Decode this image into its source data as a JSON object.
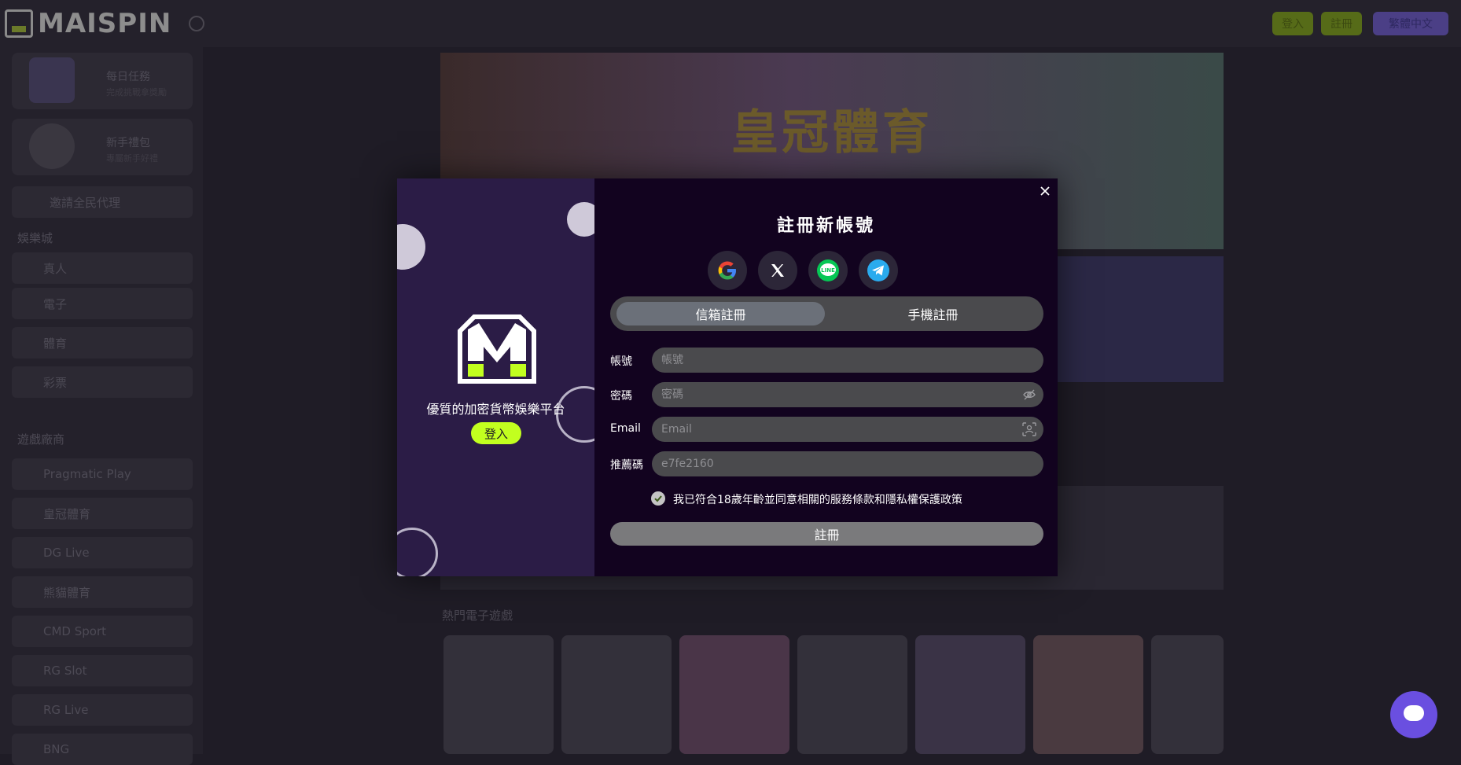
{
  "header": {
    "logo_text": "MAISPIN",
    "login_label": "登入",
    "register_label": "註冊",
    "language_label": "繁體中文"
  },
  "sidebar": {
    "cards": [
      {
        "title": "每日任務",
        "subtitle": "完成挑戰拿獎勵"
      },
      {
        "title": "新手禮包",
        "subtitle": "專屬新手好禮"
      }
    ],
    "promo_item": "邀請全民代理",
    "sections": [
      {
        "heading": "娛樂城",
        "items": [
          "真人",
          "電子",
          "體育",
          "彩票"
        ]
      },
      {
        "heading": "遊戲廠商",
        "items": [
          "Pragmatic Play",
          "皇冠體育",
          "DG Live",
          "熊貓體育",
          "CMD Sport",
          "RG Slot",
          "RG Live",
          "BNG"
        ]
      }
    ]
  },
  "main": {
    "banner_title": "皇冠體育",
    "section_title": "熱門電子遊戲"
  },
  "modal": {
    "tagline": "優質的加密貨幣娛樂平台",
    "left_login_label": "登入",
    "title": "註冊新帳號",
    "social_icons": [
      "google-icon",
      "x-icon",
      "line-icon",
      "telegram-icon"
    ],
    "tabs": [
      {
        "label": "信箱註冊",
        "active": true
      },
      {
        "label": "手機註冊",
        "active": false
      }
    ],
    "fields": {
      "account": {
        "label": "帳號",
        "placeholder": "帳號",
        "value": ""
      },
      "password": {
        "label": "密碼",
        "placeholder": "密碼",
        "value": ""
      },
      "email": {
        "label": "Email",
        "placeholder": "Email",
        "value": ""
      },
      "referral": {
        "label": "推薦碼",
        "placeholder": "e7fe2160",
        "value": ""
      }
    },
    "agree_text": "我已符合18歲年齡並同意相關的服務條款和隱私權保護政策",
    "agree_checked": true,
    "submit_label": "註冊"
  },
  "colors": {
    "accent_green": "#c2ff1f",
    "modal_left_bg": "#2b1c46",
    "modal_right_bg": "#12031f",
    "chat_purple": "#6a4fe0"
  }
}
